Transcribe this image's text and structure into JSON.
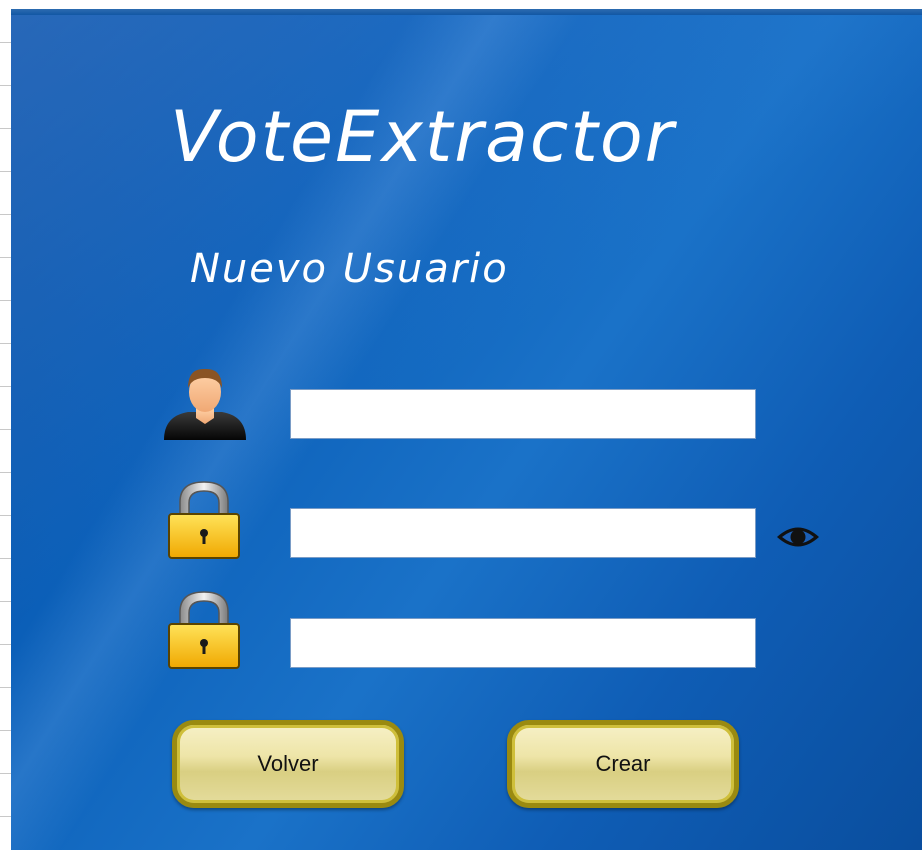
{
  "app": {
    "title": "VoteExtractor",
    "subtitle": "Nuevo Usuario"
  },
  "form": {
    "username": {
      "value": "",
      "placeholder": ""
    },
    "password": {
      "value": "",
      "placeholder": ""
    },
    "confirm_password": {
      "value": "",
      "placeholder": ""
    }
  },
  "icons": {
    "user": "user-icon",
    "password_lock": "lock-icon",
    "confirm_lock": "lock-icon",
    "show_password": "eye-icon"
  },
  "buttons": {
    "back_label": "Volver",
    "create_label": "Crear"
  },
  "colors": {
    "background": "#0b5fb8",
    "button_border": "#9a8a10",
    "button_fill": "#eee5a8",
    "text": "#ffffff"
  }
}
